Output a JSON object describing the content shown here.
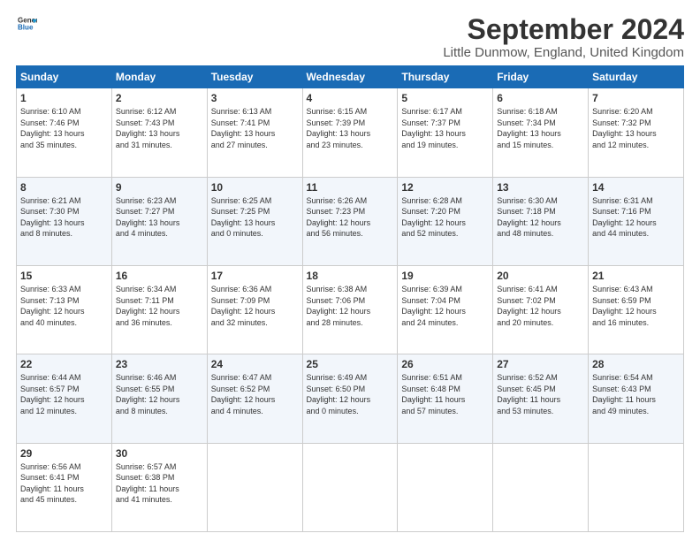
{
  "header": {
    "logo_line1": "General",
    "logo_line2": "Blue",
    "month_title": "September 2024",
    "location": "Little Dunmow, England, United Kingdom"
  },
  "weekdays": [
    "Sunday",
    "Monday",
    "Tuesday",
    "Wednesday",
    "Thursday",
    "Friday",
    "Saturday"
  ],
  "weeks": [
    [
      {
        "day": "1",
        "lines": [
          "Sunrise: 6:10 AM",
          "Sunset: 7:46 PM",
          "Daylight: 13 hours",
          "and 35 minutes."
        ]
      },
      {
        "day": "2",
        "lines": [
          "Sunrise: 6:12 AM",
          "Sunset: 7:43 PM",
          "Daylight: 13 hours",
          "and 31 minutes."
        ]
      },
      {
        "day": "3",
        "lines": [
          "Sunrise: 6:13 AM",
          "Sunset: 7:41 PM",
          "Daylight: 13 hours",
          "and 27 minutes."
        ]
      },
      {
        "day": "4",
        "lines": [
          "Sunrise: 6:15 AM",
          "Sunset: 7:39 PM",
          "Daylight: 13 hours",
          "and 23 minutes."
        ]
      },
      {
        "day": "5",
        "lines": [
          "Sunrise: 6:17 AM",
          "Sunset: 7:37 PM",
          "Daylight: 13 hours",
          "and 19 minutes."
        ]
      },
      {
        "day": "6",
        "lines": [
          "Sunrise: 6:18 AM",
          "Sunset: 7:34 PM",
          "Daylight: 13 hours",
          "and 15 minutes."
        ]
      },
      {
        "day": "7",
        "lines": [
          "Sunrise: 6:20 AM",
          "Sunset: 7:32 PM",
          "Daylight: 13 hours",
          "and 12 minutes."
        ]
      }
    ],
    [
      {
        "day": "8",
        "lines": [
          "Sunrise: 6:21 AM",
          "Sunset: 7:30 PM",
          "Daylight: 13 hours",
          "and 8 minutes."
        ]
      },
      {
        "day": "9",
        "lines": [
          "Sunrise: 6:23 AM",
          "Sunset: 7:27 PM",
          "Daylight: 13 hours",
          "and 4 minutes."
        ]
      },
      {
        "day": "10",
        "lines": [
          "Sunrise: 6:25 AM",
          "Sunset: 7:25 PM",
          "Daylight: 13 hours",
          "and 0 minutes."
        ]
      },
      {
        "day": "11",
        "lines": [
          "Sunrise: 6:26 AM",
          "Sunset: 7:23 PM",
          "Daylight: 12 hours",
          "and 56 minutes."
        ]
      },
      {
        "day": "12",
        "lines": [
          "Sunrise: 6:28 AM",
          "Sunset: 7:20 PM",
          "Daylight: 12 hours",
          "and 52 minutes."
        ]
      },
      {
        "day": "13",
        "lines": [
          "Sunrise: 6:30 AM",
          "Sunset: 7:18 PM",
          "Daylight: 12 hours",
          "and 48 minutes."
        ]
      },
      {
        "day": "14",
        "lines": [
          "Sunrise: 6:31 AM",
          "Sunset: 7:16 PM",
          "Daylight: 12 hours",
          "and 44 minutes."
        ]
      }
    ],
    [
      {
        "day": "15",
        "lines": [
          "Sunrise: 6:33 AM",
          "Sunset: 7:13 PM",
          "Daylight: 12 hours",
          "and 40 minutes."
        ]
      },
      {
        "day": "16",
        "lines": [
          "Sunrise: 6:34 AM",
          "Sunset: 7:11 PM",
          "Daylight: 12 hours",
          "and 36 minutes."
        ]
      },
      {
        "day": "17",
        "lines": [
          "Sunrise: 6:36 AM",
          "Sunset: 7:09 PM",
          "Daylight: 12 hours",
          "and 32 minutes."
        ]
      },
      {
        "day": "18",
        "lines": [
          "Sunrise: 6:38 AM",
          "Sunset: 7:06 PM",
          "Daylight: 12 hours",
          "and 28 minutes."
        ]
      },
      {
        "day": "19",
        "lines": [
          "Sunrise: 6:39 AM",
          "Sunset: 7:04 PM",
          "Daylight: 12 hours",
          "and 24 minutes."
        ]
      },
      {
        "day": "20",
        "lines": [
          "Sunrise: 6:41 AM",
          "Sunset: 7:02 PM",
          "Daylight: 12 hours",
          "and 20 minutes."
        ]
      },
      {
        "day": "21",
        "lines": [
          "Sunrise: 6:43 AM",
          "Sunset: 6:59 PM",
          "Daylight: 12 hours",
          "and 16 minutes."
        ]
      }
    ],
    [
      {
        "day": "22",
        "lines": [
          "Sunrise: 6:44 AM",
          "Sunset: 6:57 PM",
          "Daylight: 12 hours",
          "and 12 minutes."
        ]
      },
      {
        "day": "23",
        "lines": [
          "Sunrise: 6:46 AM",
          "Sunset: 6:55 PM",
          "Daylight: 12 hours",
          "and 8 minutes."
        ]
      },
      {
        "day": "24",
        "lines": [
          "Sunrise: 6:47 AM",
          "Sunset: 6:52 PM",
          "Daylight: 12 hours",
          "and 4 minutes."
        ]
      },
      {
        "day": "25",
        "lines": [
          "Sunrise: 6:49 AM",
          "Sunset: 6:50 PM",
          "Daylight: 12 hours",
          "and 0 minutes."
        ]
      },
      {
        "day": "26",
        "lines": [
          "Sunrise: 6:51 AM",
          "Sunset: 6:48 PM",
          "Daylight: 11 hours",
          "and 57 minutes."
        ]
      },
      {
        "day": "27",
        "lines": [
          "Sunrise: 6:52 AM",
          "Sunset: 6:45 PM",
          "Daylight: 11 hours",
          "and 53 minutes."
        ]
      },
      {
        "day": "28",
        "lines": [
          "Sunrise: 6:54 AM",
          "Sunset: 6:43 PM",
          "Daylight: 11 hours",
          "and 49 minutes."
        ]
      }
    ],
    [
      {
        "day": "29",
        "lines": [
          "Sunrise: 6:56 AM",
          "Sunset: 6:41 PM",
          "Daylight: 11 hours",
          "and 45 minutes."
        ]
      },
      {
        "day": "30",
        "lines": [
          "Sunrise: 6:57 AM",
          "Sunset: 6:38 PM",
          "Daylight: 11 hours",
          "and 41 minutes."
        ]
      },
      {
        "day": "",
        "lines": []
      },
      {
        "day": "",
        "lines": []
      },
      {
        "day": "",
        "lines": []
      },
      {
        "day": "",
        "lines": []
      },
      {
        "day": "",
        "lines": []
      }
    ]
  ]
}
